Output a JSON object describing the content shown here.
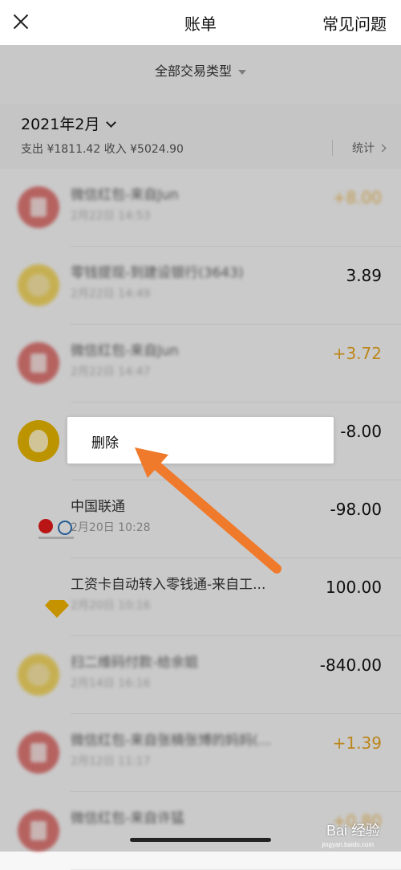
{
  "header": {
    "title": "账单",
    "faq_label": "常见问题"
  },
  "filter": {
    "label": "全部交易类型"
  },
  "month": {
    "label": "2021年2月",
    "summary": "支出 ¥1811.42 收入 ¥5024.90",
    "stats_label": "统计"
  },
  "transactions": [
    {
      "name": "微信红包-来自Jun",
      "time": "2月22日 14:53",
      "amount": "+8.00",
      "type": "income",
      "icon": "red-envelope-icon",
      "color": "#d64e4a"
    },
    {
      "name": "零钱提现-到建设银行(3643)",
      "time": "2月22日 14:49",
      "amount": "3.89",
      "type": "expense",
      "icon": "coin-icon",
      "color": "#f1cc33"
    },
    {
      "name": "微信红包-来自Jun",
      "time": "2月22日 14:47",
      "amount": "+3.72",
      "type": "income",
      "icon": "red-envelope-icon",
      "color": "#d64e4a"
    },
    {
      "name": "",
      "time": "",
      "amount": "-8.00",
      "type": "expense",
      "icon": "money-bag-icon",
      "color": "#e6b500"
    },
    {
      "name": "中国联通",
      "time": "2月20日 10:28",
      "amount": "-98.00",
      "type": "expense",
      "icon": "china-unicom-logo",
      "color": "#e21a1a"
    },
    {
      "name": "工资卡自动转入零钱通-来自工...",
      "time": "2月20日 10:16",
      "amount": "100.00",
      "type": "expense",
      "icon": "diamond-icon",
      "color": "#f2b400"
    },
    {
      "name": "扫二维码付款-给余姐",
      "time": "2月14日 16:16",
      "amount": "-840.00",
      "type": "expense",
      "icon": "coin-icon",
      "color": "#f1cc33"
    },
    {
      "name": "微信红包-来自张楠张博的妈妈(...",
      "time": "2月12日 11:17",
      "amount": "+1.39",
      "type": "income",
      "icon": "red-envelope-icon",
      "color": "#d64e4a"
    },
    {
      "name": "微信红包-来自许猛",
      "time": "",
      "amount": "+0.80",
      "type": "income",
      "icon": "red-envelope-icon",
      "color": "#d64e4a"
    }
  ],
  "context_menu": {
    "delete_label": "删除"
  },
  "watermark": {
    "text": "Bai 经验",
    "sub": "jingyan.baidu.com"
  },
  "colors": {
    "income": "#e6a421",
    "arrow": "#f07a2b"
  }
}
